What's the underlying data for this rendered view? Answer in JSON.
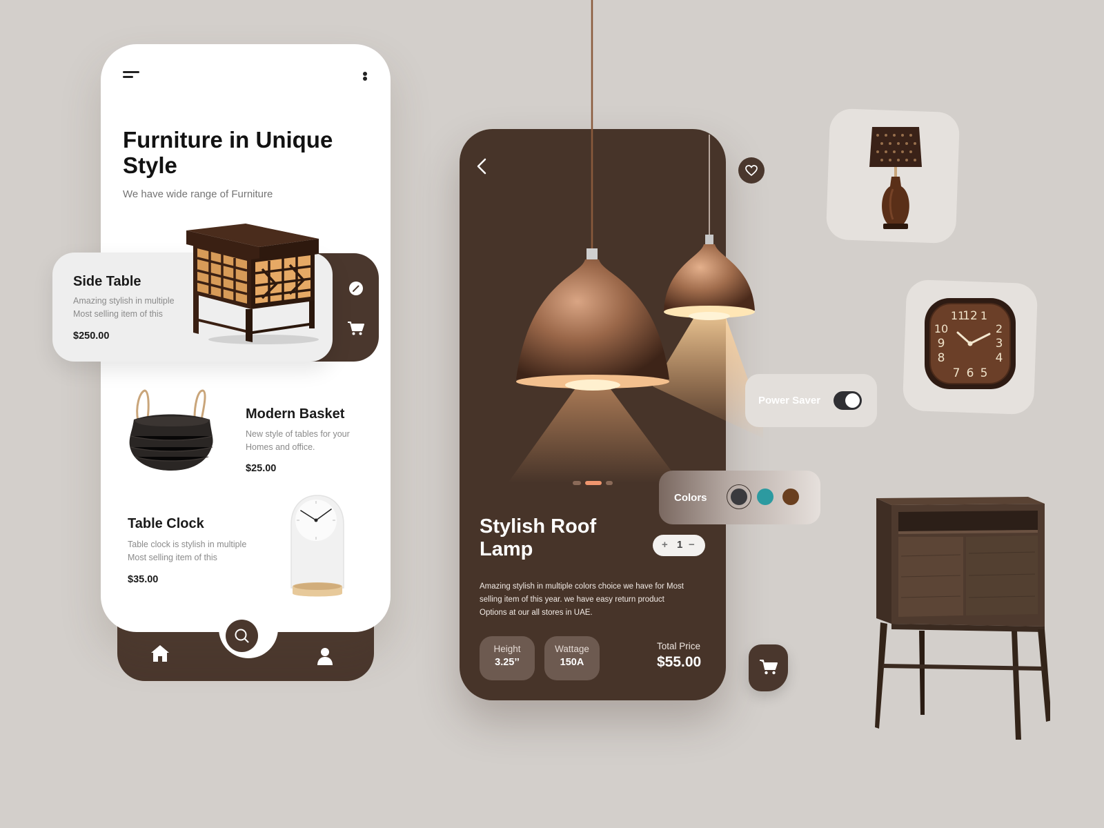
{
  "left_phone": {
    "title": "Furniture in Unique Style",
    "subtitle": "We have wide range of Furniture",
    "products": [
      {
        "name": "Side Table",
        "description": "Amazing stylish in multiple Most selling item of this",
        "price": "$250.00"
      },
      {
        "name": "Modern Basket",
        "description": "New style of  tables for your Homes and office.",
        "price": "$25.00"
      },
      {
        "name": "Table Clock",
        "description": "Table clock is stylish in multiple Most selling item of this",
        "price": "$35.00"
      }
    ],
    "nav": [
      "home-icon",
      "search-icon",
      "user-icon"
    ]
  },
  "detail": {
    "title": "Stylish Roof Lamp",
    "quantity": "1",
    "qty_plus": "+",
    "qty_minus": "−",
    "description": "Amazing stylish in multiple colors choice we have for Most selling item of this year. we have easy return product Options at our all stores in UAE.",
    "specs": [
      {
        "label": "Height",
        "value": "3.25’’"
      },
      {
        "label": "Wattage",
        "value": "150A"
      }
    ],
    "total_label": "Total Price",
    "total_value": "$55.00",
    "carousel_active": 2,
    "carousel_count": 3
  },
  "widgets": {
    "colors_label": "Colors",
    "colors": [
      "#3a3a3e",
      "#2c9aa0",
      "#6a3f1f"
    ],
    "selected_color": 1,
    "power_saver_label": "Power Saver",
    "power_saver_on": true
  },
  "theme": {
    "brown": "#4a372d",
    "background": "#d3cfcb",
    "accent": "#f0966e"
  }
}
